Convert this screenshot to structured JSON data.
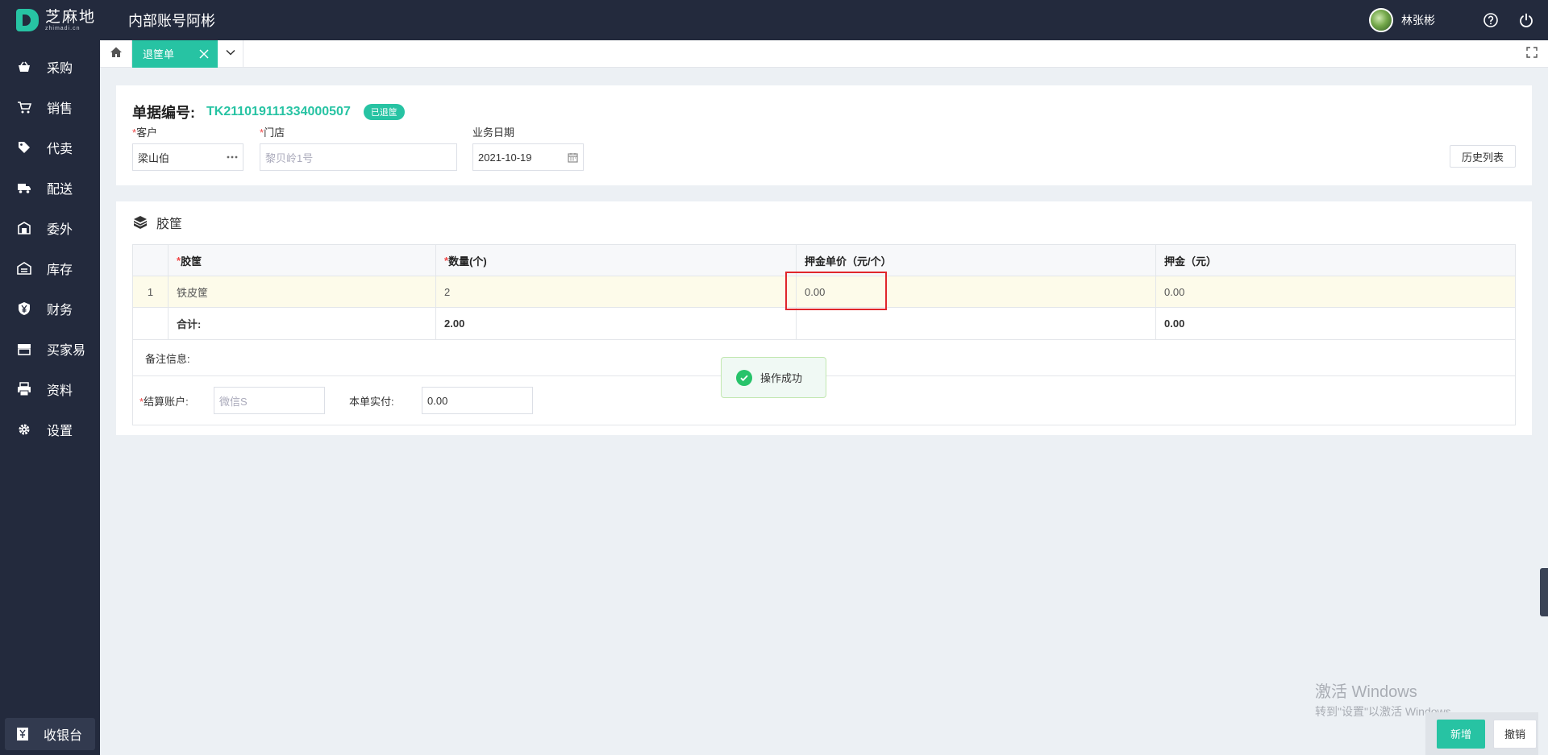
{
  "header": {
    "logo_cn": "芝麻地",
    "logo_en": "zhimadi.cn",
    "account_title": "内部账号阿彬",
    "username": "林张彬"
  },
  "sidebar": {
    "items": [
      {
        "label": "采购",
        "icon": "basket-icon"
      },
      {
        "label": "销售",
        "icon": "cart-icon"
      },
      {
        "label": "代卖",
        "icon": "tag-icon"
      },
      {
        "label": "配送",
        "icon": "truck-icon"
      },
      {
        "label": "委外",
        "icon": "building-icon"
      },
      {
        "label": "库存",
        "icon": "warehouse-icon"
      },
      {
        "label": "财务",
        "icon": "yen-icon"
      },
      {
        "label": "买家易",
        "icon": "store-icon"
      },
      {
        "label": "资料",
        "icon": "printer-icon"
      },
      {
        "label": "设置",
        "icon": "gear-icon"
      }
    ],
    "cashier_label": "收银台"
  },
  "tabs": {
    "active_label": "退筐单"
  },
  "order": {
    "doc_label": "单据编号:",
    "doc_no": "TK211019111334000507",
    "status": "已退筐",
    "customer_label": "客户",
    "customer_value": "梁山伯",
    "store_label": "门店",
    "store_placeholder": "黎贝岭1号",
    "date_label": "业务日期",
    "date_value": "2021-10-19",
    "history_button": "历史列表"
  },
  "basket": {
    "section_title": "胶筐",
    "columns": [
      "胶筐",
      "数量(个)",
      "押金单价（元/个）",
      "押金（元）"
    ],
    "rows": [
      {
        "index": "1",
        "name": "铁皮筐",
        "qty": "2",
        "unit_price": "0.00",
        "deposit": "0.00"
      }
    ],
    "total_label": "合计:",
    "total_qty": "2.00",
    "total_deposit": "0.00",
    "remark_label": "备注信息:",
    "settle_label": "结算账户:",
    "settle_placeholder": "微信S",
    "paid_label": "本单实付:",
    "paid_value": "0.00"
  },
  "toast": {
    "message": "操作成功"
  },
  "watermark": {
    "line1": "激活 Windows",
    "line2": "转到\"设置\"以激活 Windows。"
  },
  "actions": {
    "new_label": "新增",
    "cancel_label": "撤销"
  },
  "colors": {
    "accent": "#27c3a3",
    "sidebar_bg": "#232a3d",
    "highlight": "#e0262b"
  }
}
